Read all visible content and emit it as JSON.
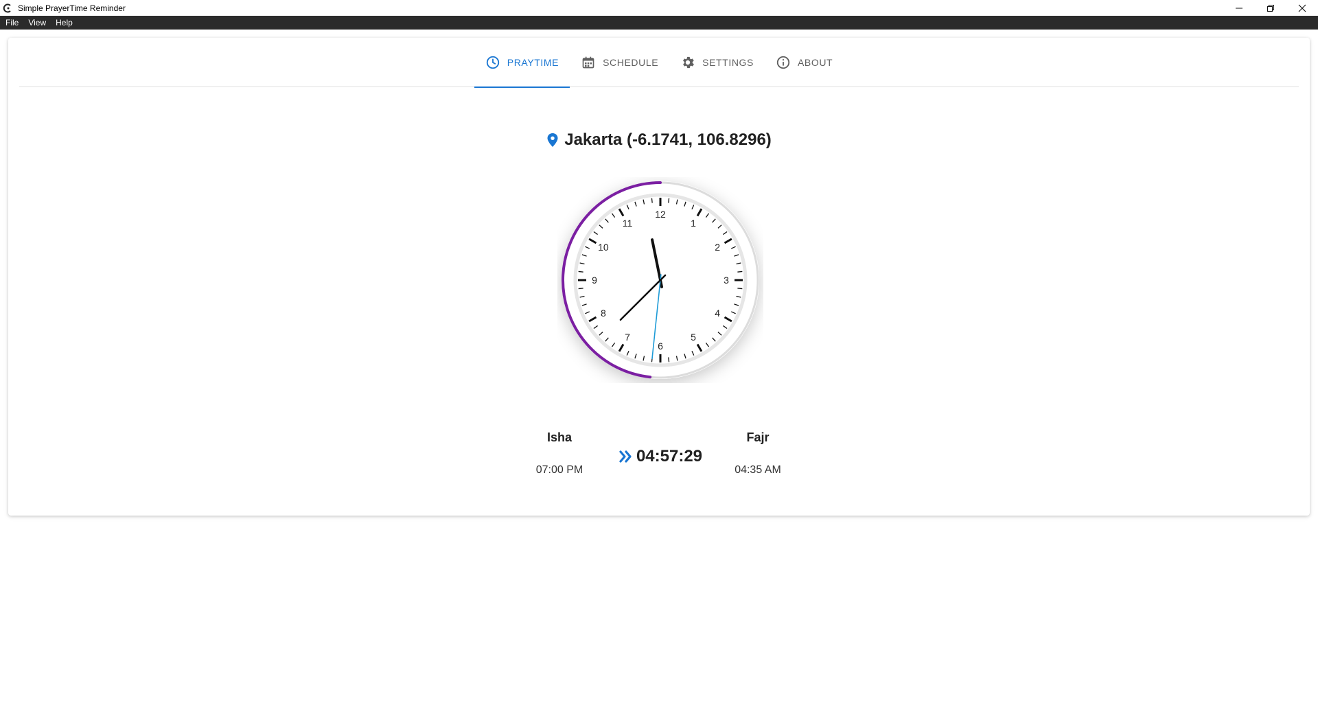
{
  "window": {
    "title": "Simple PrayerTime Reminder",
    "minimize_icon": "minimize-icon",
    "restore_icon": "restore-icon",
    "close_icon": "close-icon"
  },
  "menu": [
    "File",
    "View",
    "Help"
  ],
  "tabs": [
    {
      "label": "PRAYTIME",
      "icon": "clock-icon",
      "active": true
    },
    {
      "label": "SCHEDULE",
      "icon": "calendar-icon",
      "active": false
    },
    {
      "label": "SETTINGS",
      "icon": "gear-icon",
      "active": false
    },
    {
      "label": "ABOUT",
      "icon": "info-icon",
      "active": false
    }
  ],
  "location": {
    "text": "Jakarta (-6.1741, 106.8296)",
    "icon": "location-pin-icon"
  },
  "clock": {
    "numbers": [
      "12",
      "1",
      "2",
      "3",
      "4",
      "5",
      "6",
      "7",
      "8",
      "9",
      "10",
      "11"
    ],
    "time": {
      "hour": 11,
      "minute": 37,
      "second": 31
    },
    "progress_arc_color": "#7b1fa2",
    "second_hand_color": "#1e9bd7"
  },
  "previous_prayer": {
    "name": "Isha",
    "time": "07:00 PM"
  },
  "next_prayer": {
    "name": "Fajr",
    "time": "04:35 AM"
  },
  "countdown": {
    "value": "04:57:29",
    "icon": "double-chevron-right-icon"
  },
  "colors": {
    "accent": "#1976d2",
    "menubar": "#2b2b2b"
  }
}
